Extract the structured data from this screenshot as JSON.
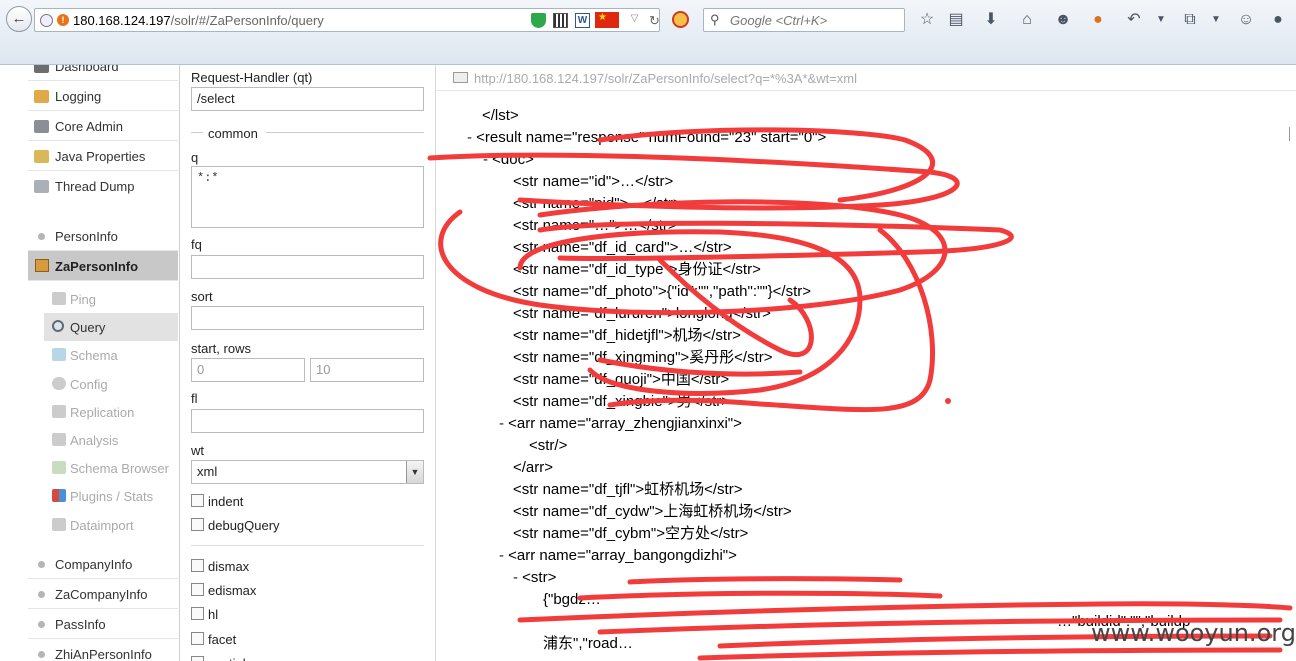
{
  "browser": {
    "url_host": "180.168.124.197",
    "url_path": "/solr/#/ZaPersonInfo/query",
    "search_placeholder": "Google <Ctrl+K>"
  },
  "nav": {
    "main_items": [
      {
        "label": "Dashboard",
        "icon": "dashboard-icon"
      },
      {
        "label": "Logging",
        "icon": "logging-icon"
      },
      {
        "label": "Core Admin",
        "icon": "core-admin-icon"
      },
      {
        "label": "Java Properties",
        "icon": "java-properties-icon"
      },
      {
        "label": "Thread Dump",
        "icon": "thread-dump-icon"
      }
    ],
    "cores_top": [
      {
        "label": "PersonInfo"
      },
      {
        "label": "ZaPersonInfo"
      }
    ],
    "core_sub": [
      {
        "label": "Ping",
        "icon": "ping-icon"
      },
      {
        "label": "Query",
        "icon": "query-icon"
      },
      {
        "label": "Schema",
        "icon": "schema-icon"
      },
      {
        "label": "Config",
        "icon": "config-icon"
      },
      {
        "label": "Replication",
        "icon": "replication-icon"
      },
      {
        "label": "Analysis",
        "icon": "analysis-icon"
      },
      {
        "label": "Schema Browser",
        "icon": "schema-browser-icon"
      },
      {
        "label": "Plugins / Stats",
        "icon": "plugins-icon"
      },
      {
        "label": "Dataimport",
        "icon": "dataimport-icon"
      }
    ],
    "cores_bottom": [
      {
        "label": "CompanyInfo"
      },
      {
        "label": "ZaCompanyInfo"
      },
      {
        "label": "PassInfo"
      },
      {
        "label": "ZhiAnPersonInfo"
      }
    ]
  },
  "form": {
    "request_handler_label": "Request-Handler (qt)",
    "request_handler_value": "/select",
    "common_label": "common",
    "q_label": "q",
    "q_value": "*:*",
    "fq_label": "fq",
    "sort_label": "sort",
    "start_rows_label": "start, rows",
    "start_value": "0",
    "rows_value": "10",
    "fl_label": "fl",
    "wt_label": "wt",
    "wt_value": "xml",
    "indent_label": "indent",
    "debug_label": "debugQuery",
    "dismax_label": "dismax",
    "edismax_label": "edismax",
    "hl_label": "hl",
    "facet_label": "facet",
    "spatial_label": "spatial"
  },
  "response": {
    "request_url": "http://180.168.124.197/solr/ZaPersonInfo/select?q=*%3A*&wt=xml",
    "lines": [
      "</lst>",
      "<result name=\"response\" numFound=\"23\" start=\"0\">",
      "<doc>",
      "<str name=\"id\">…</str>",
      "<str name=\"pid\">…</str>",
      "<str name=\"…\">…</str>",
      "<str name=\"df_id_card\">…</str>",
      "<str name=\"df_id_type\">身份证</str>",
      "<str name=\"df_photo\">{\"id\":\"\",\"path\":\"\"}</str>",
      "<str name=\"df_lururen\">longlong</str>",
      "<str name=\"df_hidetjfl\">机场</str>",
      "<str name=\"df_xingming\">奚丹彤</str>",
      "<str name=\"df_guoji\">中国</str>",
      "<str name=\"df_xingbie\">男</str>",
      "<arr name=\"array_zhengjianxinxi\">",
      "<str/>",
      "</arr>",
      "<str name=\"df_tjfl\">虹桥机场</str>",
      "<str name=\"df_cydw\">上海虹桥机场</str>",
      "<str name=\"df_cybm\">空方处</str>",
      "<arr name=\"array_bangongdizhi\">",
      "<str>",
      "{\"bgdz…",
      "…\"buildid\":\"\",\"buildp",
      "浦东\",\"road…"
    ]
  },
  "watermark": "www.wooyun.org"
}
